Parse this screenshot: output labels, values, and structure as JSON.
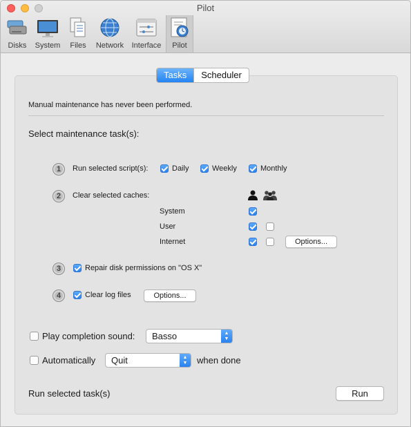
{
  "window": {
    "title": "Pilot"
  },
  "toolbar": {
    "items": [
      {
        "label": "Disks",
        "icon": "disks-icon"
      },
      {
        "label": "System",
        "icon": "system-icon"
      },
      {
        "label": "Files",
        "icon": "files-icon"
      },
      {
        "label": "Network",
        "icon": "network-icon"
      },
      {
        "label": "Interface",
        "icon": "interface-icon"
      },
      {
        "label": "Pilot",
        "icon": "pilot-icon",
        "selected": true
      }
    ]
  },
  "tabs": {
    "tasks": "Tasks",
    "scheduler": "Scheduler",
    "active": "Tasks"
  },
  "status_text": "Manual maintenance has never been performed.",
  "heading": "Select maintenance task(s):",
  "tasks": {
    "t1": {
      "number": "1",
      "label": "Run selected script(s):",
      "daily": {
        "label": "Daily",
        "checked": true
      },
      "weekly": {
        "label": "Weekly",
        "checked": true
      },
      "monthly": {
        "label": "Monthly",
        "checked": true
      }
    },
    "t2": {
      "number": "2",
      "label": "Clear selected caches:",
      "columns": [
        "single-user-icon",
        "multi-user-icon"
      ],
      "rows": [
        {
          "label": "System",
          "user": true,
          "all": null
        },
        {
          "label": "User",
          "user": true,
          "all": false
        },
        {
          "label": "Internet",
          "user": true,
          "all": false
        }
      ],
      "options_label": "Options..."
    },
    "t3": {
      "number": "3",
      "label": "Repair disk permissions on \"OS X\"",
      "checked": true
    },
    "t4": {
      "number": "4",
      "label": "Clear log files",
      "checked": true,
      "options_label": "Options..."
    }
  },
  "sound": {
    "label": "Play completion sound:",
    "checked": false,
    "value": "Basso"
  },
  "auto": {
    "label": "Automatically",
    "checked": false,
    "value": "Quit",
    "suffix": "when done"
  },
  "run": {
    "label": "Run selected task(s)",
    "button": "Run"
  }
}
